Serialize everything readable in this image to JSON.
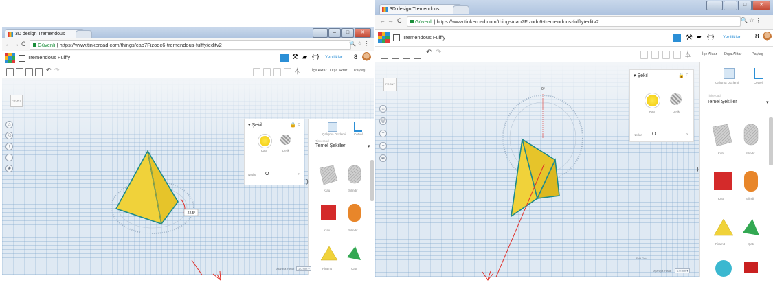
{
  "left": {
    "browser": {
      "tab_title": "3D design Tremendous",
      "tab_close": "✕",
      "url_secure": "Güvenli",
      "url": "https://www.tinkercad.com/things/cab7Fizodc6-tremendous-fulffy/editv2"
    },
    "app": {
      "design_name": "Tremendous Fulffy",
      "news_label": "Yenilikler"
    },
    "toolbar": {
      "import": "İçe Aktar",
      "export": "Dışa Aktar",
      "share": "Paylaş"
    },
    "shape_panel": {
      "title": "Şekil",
      "solid": "Katı",
      "hole": "Delik",
      "notes": "Notlar",
      "notes_val": "O"
    },
    "library": {
      "workplane": "Çalışma Düzlemi",
      "ruler": "Cetvel",
      "category_small": "Tinkercad",
      "category": "Temel Şekiller",
      "shapes": [
        "Kutu",
        "Silindir",
        "Kutu",
        "Silindir",
        "Piramit",
        "Çatı"
      ]
    },
    "angle": "-22.5°",
    "edit_grid": "Edit Grid",
    "snap_label": "Izgaraya Yaslat",
    "snap_value": "1.0 mm ▾"
  },
  "right": {
    "browser": {
      "tab_title": "3D design Tremendous",
      "tab_close": "✕",
      "url_secure": "Güvenli",
      "url": "https://www.tinkercad.com/things/cab7Fizodc6-tremendous-fulffy/editv2"
    },
    "app": {
      "design_name": "Tremendous Fulffy",
      "news_label": "Yenilikler"
    },
    "toolbar": {
      "import": "İçe Aktar",
      "export": "Dışa Aktar",
      "share": "Paylaş"
    },
    "shape_panel": {
      "title": "Şekil",
      "solid": "Katı",
      "hole": "Delik",
      "notes": "Notlar",
      "notes_val": "O"
    },
    "library": {
      "workplane": "Çalışma Düzlemi",
      "ruler": "Cetvel",
      "category_small": "Tinkercad",
      "category": "Temel Şekiller",
      "shapes": [
        "Kutu",
        "Silindir",
        "Kutu",
        "Silindir",
        "Piramit",
        "Çatı"
      ]
    },
    "angle": "0°",
    "edit_grid": "Edit Grid",
    "snap_label": "Izgaraya Yaslat",
    "snap_value": "1.0 mm ▾"
  },
  "colors": {
    "pyramid": "#f0d23a",
    "pyramid_edge": "#1f8a8c",
    "annotation_arrow": "#e0302a",
    "accent": "#2b8fd6",
    "box_red": "#d42a2a",
    "cyl_orange": "#e8862a",
    "roof_green": "#33a852"
  }
}
